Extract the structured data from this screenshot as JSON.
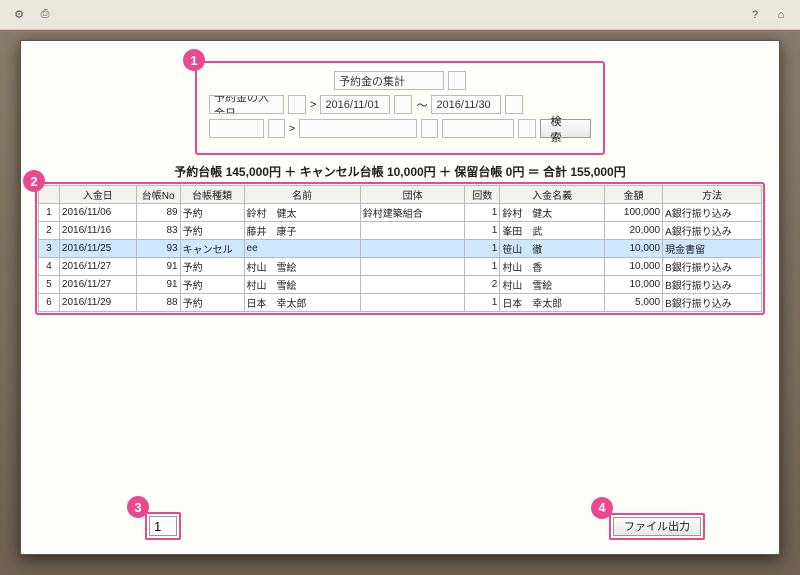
{
  "topbar": {
    "gear": "⚙",
    "print": "⎙",
    "help": "?",
    "home": "⌂"
  },
  "search": {
    "title": "予約金の集計",
    "deposit_label": "予約金の入金日",
    "gt1": ">",
    "range_sep": "～",
    "gt2": ">",
    "date_from": "2016/11/01",
    "date_to": "2016/11/30",
    "search_btn": "検　索"
  },
  "summary_line": "予約台帳 145,000円 ＋ キャンセル台帳 10,000円 ＋ 保留台帳 0円 ＝ 合計 155,000円",
  "grid": {
    "headers": [
      "",
      "入金日",
      "台帳No",
      "台帳種類",
      "名前",
      "団体",
      "回数",
      "入金名義",
      "金額",
      "方法"
    ],
    "rows": [
      {
        "idx": "1",
        "date": "2016/11/06",
        "no": "89",
        "kind": "予約",
        "name": "鈴村　健太",
        "org": "鈴村建築組合",
        "cnt": "1",
        "payer": "鈴村　健太",
        "amt": "100,000",
        "method": "A銀行振り込み",
        "sel": false
      },
      {
        "idx": "2",
        "date": "2016/11/16",
        "no": "83",
        "kind": "予約",
        "name": "藤井　康子",
        "org": "",
        "cnt": "1",
        "payer": "峯田　武",
        "amt": "20,000",
        "method": "A銀行振り込み",
        "sel": false
      },
      {
        "idx": "3",
        "date": "2016/11/25",
        "no": "93",
        "kind": "キャンセル",
        "name": "ee",
        "org": "",
        "cnt": "1",
        "payer": "笹山　徹",
        "amt": "10,000",
        "method": "現金書留",
        "sel": true
      },
      {
        "idx": "4",
        "date": "2016/11/27",
        "no": "91",
        "kind": "予約",
        "name": "村山　雪絵",
        "org": "",
        "cnt": "1",
        "payer": "村山　香",
        "amt": "10,000",
        "method": "B銀行振り込み",
        "sel": false
      },
      {
        "idx": "5",
        "date": "2016/11/27",
        "no": "91",
        "kind": "予約",
        "name": "村山　雪絵",
        "org": "",
        "cnt": "2",
        "payer": "村山　雪絵",
        "amt": "10,000",
        "method": "B銀行振り込み",
        "sel": false
      },
      {
        "idx": "6",
        "date": "2016/11/29",
        "no": "88",
        "kind": "予約",
        "name": "日本　幸太郎",
        "org": "",
        "cnt": "1",
        "payer": "日本　幸太郎",
        "amt": "5,000",
        "method": "B銀行振り込み",
        "sel": false
      }
    ]
  },
  "footer": {
    "page": "1",
    "export_btn": "ファイル出力"
  },
  "callouts": {
    "c1": "1",
    "c2": "2",
    "c3": "3",
    "c4": "4"
  }
}
